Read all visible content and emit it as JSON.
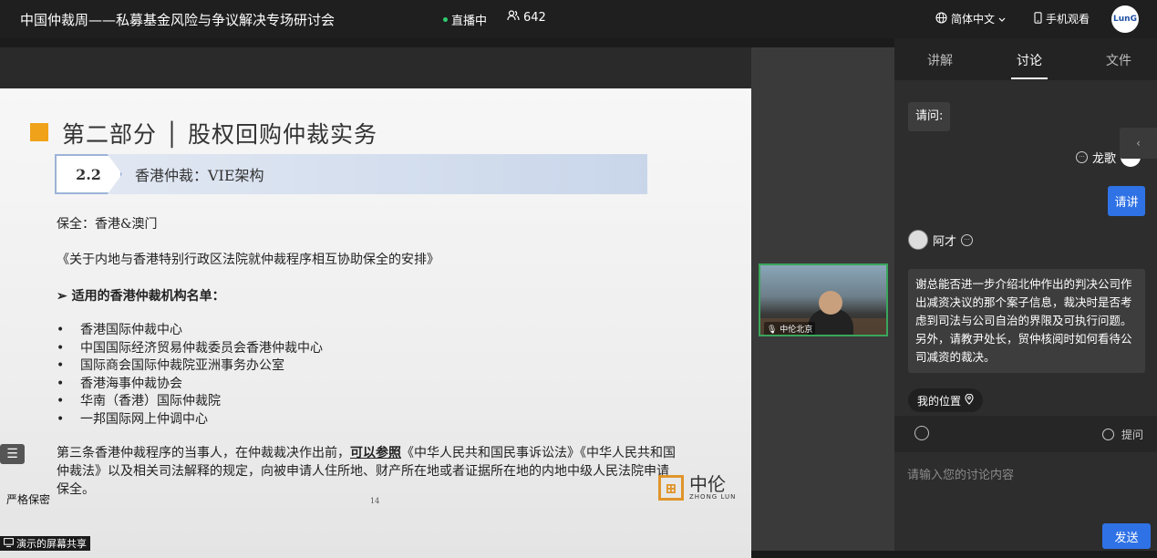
{
  "header": {
    "title": "中国仲裁周——私募基金风险与争议解决专场研讨会",
    "live_label": "直播中",
    "viewer_count": "642",
    "language": "简体中文",
    "mobile_watch": "手机观看"
  },
  "slide": {
    "section_title": "第二部分 │ 股权回购仲裁实务",
    "badge": "2.2",
    "banner_text": "香港仲裁：VIE架构",
    "line1": "保全：香港&澳门",
    "line2": "《关于内地与香港特别行政区法院就仲裁程序相互协助保全的安排》",
    "line3": "➢  适用的香港仲裁机构名单：",
    "institutions": [
      "香港国际仲裁中心",
      "中国国际经济贸易仲裁委员会香港仲裁中心",
      "国际商会国际仲裁院亚洲事务办公室",
      "香港海事仲裁协会",
      "华南（香港）国际仲裁院",
      "一邦国际网上仲调中心"
    ],
    "para_a": "第三条香港仲裁程序的当事人，在仲裁裁决作出前，",
    "para_bold": "可以参照",
    "para_b": "《中华人民共和国民事诉讼法》《中华人民共和国仲裁法》以及相关司法解释的规定，向被申请人住所地、财产所在地或者证据所在地的内地中级人民法院申请保全。",
    "page_number": "14",
    "logo_cn": "中伦",
    "logo_en": "ZHONG LUN",
    "confidential": "严格保密"
  },
  "camera": {
    "label": "中伦北京"
  },
  "share_label": "演示的屏幕共享",
  "panel": {
    "tabs": [
      "讲解",
      "讨论",
      "文件"
    ],
    "msg1": "请问:",
    "user1_name": "龙歌",
    "reply_button": "请讲",
    "user2_name": "阿才",
    "msg2": "谢总能否进一步介绍北仲作出的判决公司作出减资决议的那个案子信息，裁决时是否考虑到司法与公司自治的界限及可执行问题。另外，请教尹处长，贸仲核阅时如何看待公司减资的裁决。",
    "location": "我的位置",
    "ask_label": "提问",
    "placeholder": "请输入您的讨论内容",
    "send": "发送"
  }
}
